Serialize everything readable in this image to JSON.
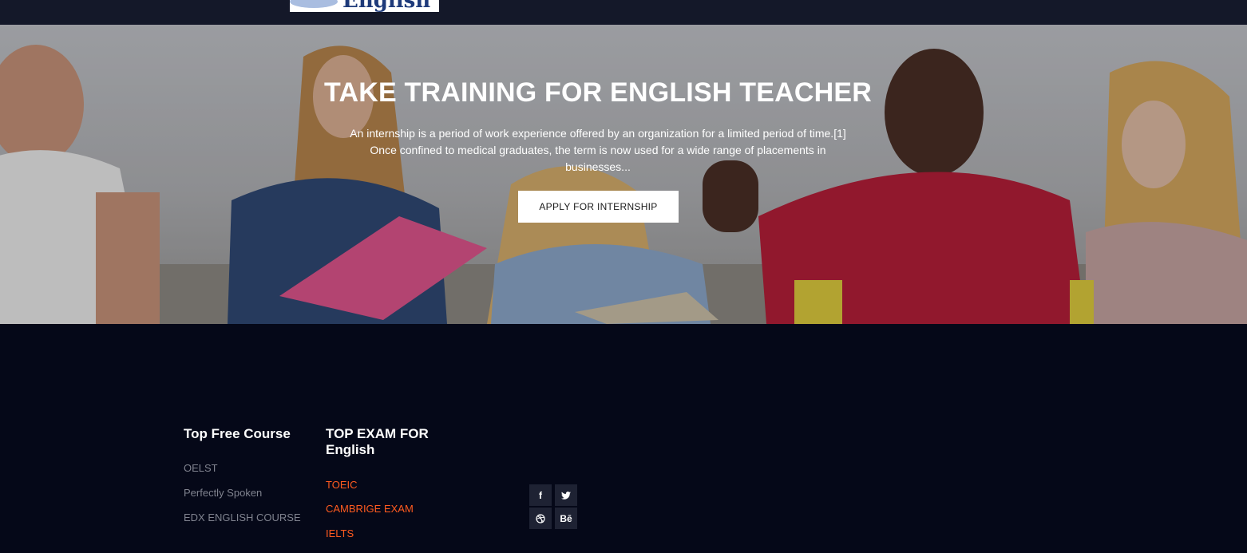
{
  "header": {
    "logo_text": "English"
  },
  "hero": {
    "title": "TAKE TRAINING FOR ENGLISH TEACHER",
    "description": "An internship is a period of work experience offered by an organization for a limited period of time.[1] Once confined to medical graduates, the term is now used for a wide range of placements in businesses...",
    "button_label": "APPLY FOR INTERNSHIP"
  },
  "footer": {
    "col1": {
      "title": "Top Free Course",
      "links": [
        "OELST",
        "Perfectly Spoken",
        "EDX ENGLISH COURSE"
      ]
    },
    "col2": {
      "title": "TOP EXAM FOR English",
      "links": [
        "TOEIC",
        "CAMBRIGE EXAM",
        "IELTS"
      ]
    },
    "social": [
      {
        "icon": "facebook-icon",
        "glyph": "f"
      },
      {
        "icon": "twitter-icon",
        "glyph": "🐦"
      },
      {
        "icon": "dribbble-icon",
        "glyph": "⊛"
      },
      {
        "icon": "behance-icon",
        "glyph": "Bē"
      }
    ]
  },
  "colors": {
    "accent": "#ff5b1f",
    "footer_bg": "#050818",
    "topbar_bg": "#141829"
  }
}
